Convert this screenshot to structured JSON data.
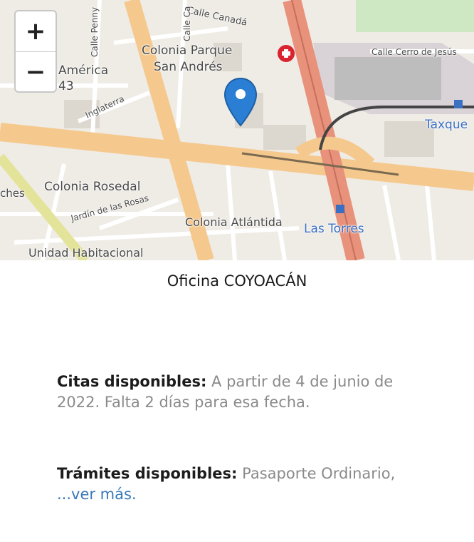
{
  "map": {
    "zoom_in": "+",
    "zoom_out": "−",
    "labels": {
      "calle_canada": "Calle Canadá",
      "colonia_parque": "Colonia Parque",
      "san_andres": "San Andrés",
      "america": "América",
      "num_43": "43",
      "inglaterra": "Inglaterra",
      "calle_cerro": "Calle Cerro de Jesús",
      "taxque": "Taxque",
      "colonia_rosedal": "Colonia Rosedal",
      "jardin_rosas": "Jardín de las Rosas",
      "colonia_atlantida": "Colonia Atlántida",
      "las_torres": "Las Torres",
      "unidad_habitacional": "Unidad Habitacional",
      "calle_penny": "Calle Penny",
      "calle_ca": "Calle Ca",
      "ches": "ches"
    },
    "colors": {
      "road": "#f5c98e",
      "highway": "#e8927c",
      "land": "#efece6",
      "pin": "#2a7fd4",
      "hospital": "#d9232e",
      "metro": "#3a6fc1"
    }
  },
  "office": {
    "title": "Oficina COYOACÁN",
    "citas_label": "Citas disponibles:",
    "citas_value": "A partir de 4 de junio de 2022. Falta 2 días para esa fecha.",
    "tramites_label": "Trámites disponibles:",
    "tramites_value": "Pasaporte Ordinario,",
    "ver_mas": "...ver más."
  }
}
